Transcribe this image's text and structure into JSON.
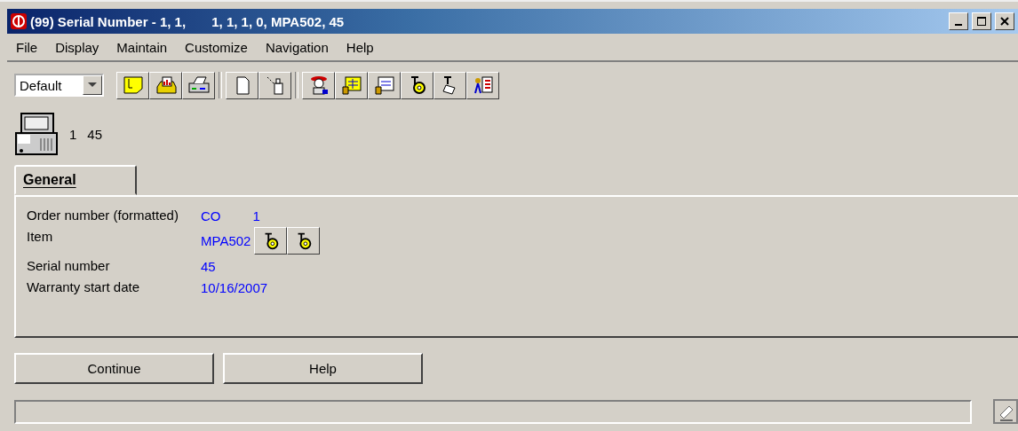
{
  "window": {
    "title": "(99) Serial Number - 1, 1,       1, 1, 1, 0, MPA502, 45"
  },
  "menu": [
    "File",
    "Display",
    "Maintain",
    "Customize",
    "Navigation",
    "Help"
  ],
  "toolbar": {
    "view_select": {
      "value": "Default"
    },
    "groups": [
      [
        {
          "kind": "note"
        },
        {
          "kind": "report"
        },
        {
          "kind": "print"
        }
      ],
      [
        {
          "kind": "page"
        },
        {
          "kind": "bin"
        }
      ],
      [
        {
          "kind": "agent"
        },
        {
          "kind": "grid-hand"
        },
        {
          "kind": "form-hand"
        },
        {
          "kind": "gear"
        },
        {
          "kind": "scroll"
        },
        {
          "kind": "list-person"
        }
      ]
    ]
  },
  "header": {
    "values": [
      "1",
      "45"
    ]
  },
  "tabs": [
    {
      "label": "General",
      "selected": true
    }
  ],
  "fields": [
    {
      "label": "Order number (formatted)",
      "values": [
        "CO",
        "1"
      ]
    },
    {
      "label": "Item",
      "values": [
        "MPA502"
      ],
      "lookups": [
        {
          "kind": "gear"
        },
        {
          "kind": "gear"
        }
      ]
    },
    {
      "label": "Serial number",
      "values": [
        "45"
      ]
    },
    {
      "label": "Warranty start date",
      "values": [
        "10/16/2007"
      ]
    }
  ],
  "buttons": [
    "Continue",
    "Help"
  ]
}
